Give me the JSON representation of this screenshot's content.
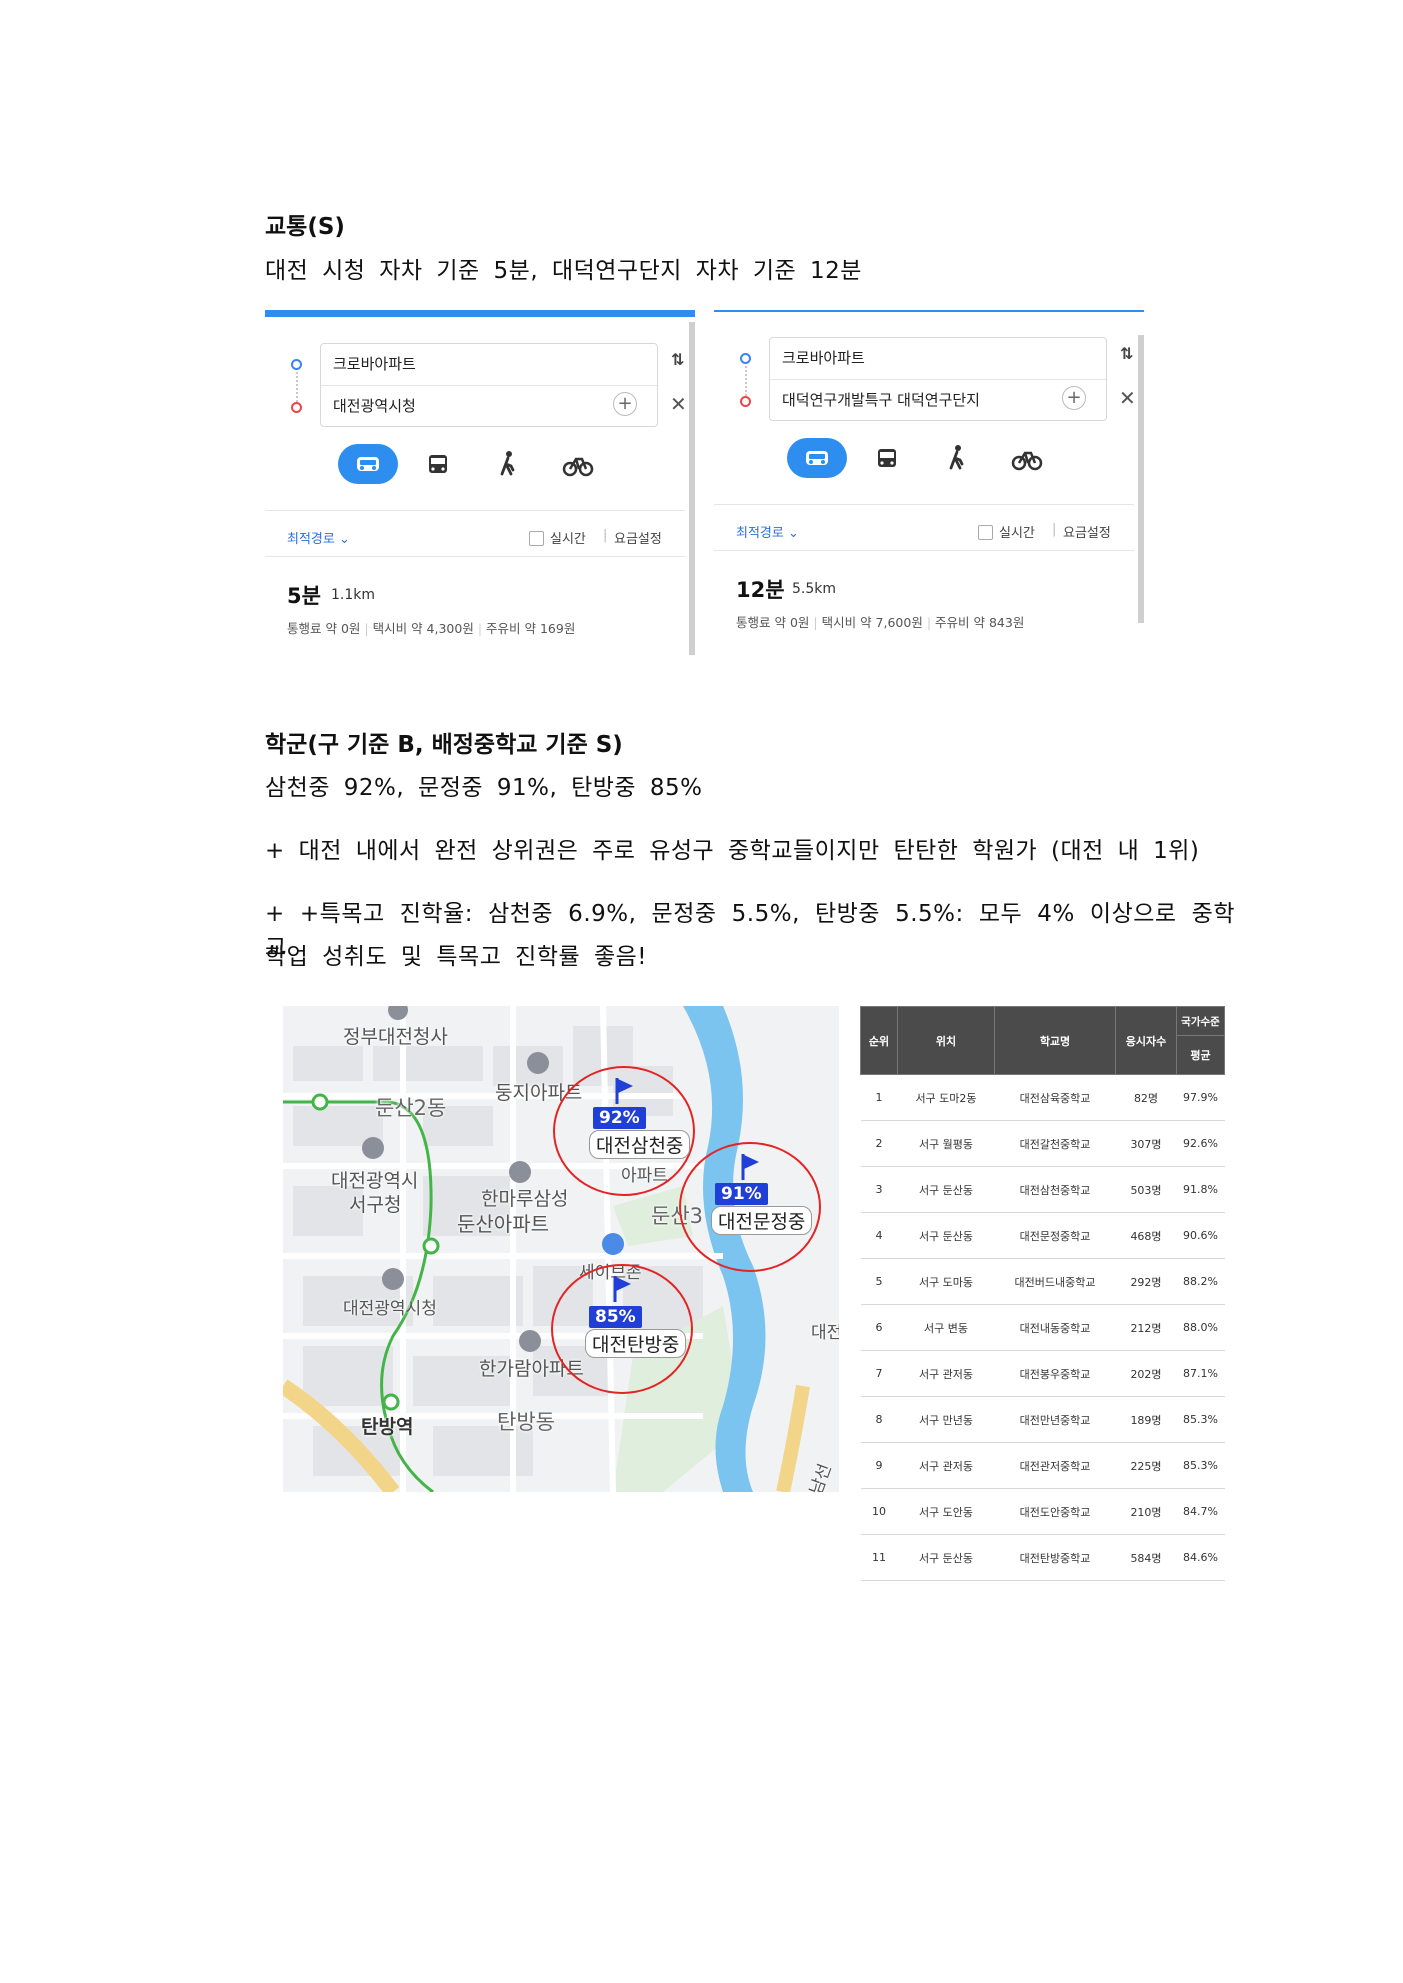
{
  "traffic": {
    "heading": "교통(S)",
    "text": "대전 시청 자차 기준 5분, 대덕연구단지 자차 기준 12분"
  },
  "route_panels": [
    {
      "origin": "크로바아파트",
      "destination": "대전광역시청",
      "option_label": "최적경로 ⌄",
      "realtime_label": "실시간",
      "fare_label": "요금설정",
      "time": "5분",
      "distance": "1.1km",
      "toll": "통행료 약 0원",
      "taxi": "택시비 약 4,300원",
      "fuel": "주유비 약 169원"
    },
    {
      "origin": "크로바아파트",
      "destination": "대덕연구개발특구 대덕연구단지",
      "option_label": "최적경로 ⌄",
      "realtime_label": "실시간",
      "fare_label": "요금설정",
      "time": "12분",
      "distance": "5.5km",
      "toll": "통행료 약 0원",
      "taxi": "택시비 약 7,600원",
      "fuel": "주유비 약 843원"
    }
  ],
  "school": {
    "heading": "학군(구 기준 B, 배정중학교 기준 S)",
    "line1": "삼천중 92%, 문정중 91%, 탄방중 85%",
    "line2": "+ 대전 내에서 완전 상위권은 주로 유성구 중학교들이지만 탄탄한 학원가 (대전 내 1위)",
    "line3a": "+ +특목고 진학율: 삼천중 6.9%, 문정중 5.5%, 탄방중 5.5%: 모두 4% 이상으로 중학교",
    "line3b": "학업 성취도 및 특목고 진학률 좋음!"
  },
  "map": {
    "labels": {
      "l1": "정부대전청사",
      "l2": "둥지아파트",
      "l3": "둔산2동",
      "l4": "대전광역시",
      "l5": "서구청",
      "l6": "한마루삼성",
      "l7": "둔산아파트",
      "l8": "아파트",
      "l9": "둔산3",
      "l10": "세이브존",
      "l11": "대전광역시청",
      "l12": "한가람아파트",
      "l13": "탄방역",
      "l14": "탄방동",
      "l15": "대전",
      "l16": "남선"
    },
    "markers": [
      {
        "pct": "92%",
        "name": "대전삼천중"
      },
      {
        "pct": "91%",
        "name": "대전문정중"
      },
      {
        "pct": "85%",
        "name": "대전탄방중"
      }
    ],
    "colors": {
      "ring": "#e32424",
      "marker": "#1f3fd6",
      "river": "#7cc4f0",
      "subway": "#43b548"
    }
  },
  "table": {
    "headers": {
      "rank": "순위",
      "location": "위치",
      "school": "학교명",
      "count": "응시자수",
      "national": "국가수준",
      "avg": "평균"
    },
    "rows": [
      {
        "rank": "1",
        "location": "서구 도마2동",
        "school": "대전삼육중학교",
        "count": "82명",
        "avg": "97.9%"
      },
      {
        "rank": "2",
        "location": "서구 월평동",
        "school": "대전갈천중학교",
        "count": "307명",
        "avg": "92.6%"
      },
      {
        "rank": "3",
        "location": "서구 둔산동",
        "school": "대전삼천중학교",
        "count": "503명",
        "avg": "91.8%"
      },
      {
        "rank": "4",
        "location": "서구 둔산동",
        "school": "대전문정중학교",
        "count": "468명",
        "avg": "90.6%"
      },
      {
        "rank": "5",
        "location": "서구 도마동",
        "school": "대전버드내중학교",
        "count": "292명",
        "avg": "88.2%"
      },
      {
        "rank": "6",
        "location": "서구 변동",
        "school": "대전내동중학교",
        "count": "212명",
        "avg": "88.0%"
      },
      {
        "rank": "7",
        "location": "서구 관저동",
        "school": "대전봉우중학교",
        "count": "202명",
        "avg": "87.1%"
      },
      {
        "rank": "8",
        "location": "서구 만년동",
        "school": "대전만년중학교",
        "count": "189명",
        "avg": "85.3%"
      },
      {
        "rank": "9",
        "location": "서구 관저동",
        "school": "대전관저중학교",
        "count": "225명",
        "avg": "85.3%"
      },
      {
        "rank": "10",
        "location": "서구 도안동",
        "school": "대전도안중학교",
        "count": "210명",
        "avg": "84.7%"
      },
      {
        "rank": "11",
        "location": "서구 둔산동",
        "school": "대전탄방중학교",
        "count": "584명",
        "avg": "84.6%"
      }
    ]
  }
}
